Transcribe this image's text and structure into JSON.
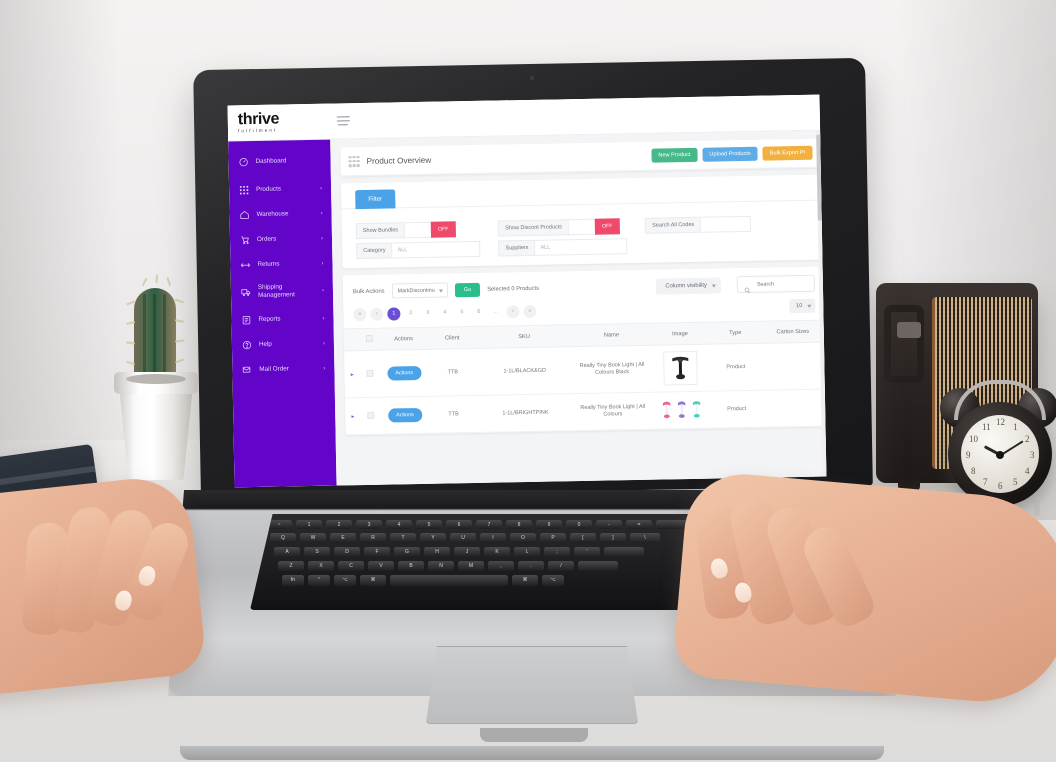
{
  "brand": {
    "logo_main": "thrive",
    "logo_sub": "fulfilment",
    "purple": "#6304c9"
  },
  "sidebar": {
    "items": [
      {
        "label": "Dashboard",
        "icon": "dashboard-icon",
        "has_chevron": false
      },
      {
        "label": "Products",
        "icon": "products-grid-icon",
        "has_chevron": true
      },
      {
        "label": "Warehouse",
        "icon": "warehouse-icon",
        "has_chevron": true
      },
      {
        "label": "Orders",
        "icon": "cart-icon",
        "has_chevron": true
      },
      {
        "label": "Returns",
        "icon": "returns-arrows-icon",
        "has_chevron": true
      },
      {
        "label": "Shipping Management",
        "icon": "truck-icon",
        "has_chevron": true
      },
      {
        "label": "Reports",
        "icon": "report-clipboard-icon",
        "has_chevron": true
      },
      {
        "label": "Help",
        "icon": "question-circle-icon",
        "has_chevron": true
      },
      {
        "label": "Mail Order",
        "icon": "mail-order-icon",
        "has_chevron": true
      }
    ],
    "chevron_glyph": "›"
  },
  "topbar": {
    "menu_icon": "hamburger-icon"
  },
  "page": {
    "title": "Product Overview",
    "grid_icon": "grid-dots-icon",
    "buttons": [
      {
        "label": "New Product",
        "color": "#45b98a"
      },
      {
        "label": "Upload Products",
        "color": "#5cace8"
      },
      {
        "label": "Bulk Export Pr",
        "color": "#f2b13f"
      }
    ]
  },
  "filter": {
    "tab_label": "Filter",
    "tab_color": "#4aa3e8",
    "off_label": "OFF",
    "off_color": "#ef4a6b",
    "fields": [
      {
        "label": "Show Bundles",
        "type": "toggle",
        "value": "OFF"
      },
      {
        "label": "Category",
        "type": "input",
        "value": "ALL"
      },
      {
        "label": "Show Discont Products",
        "type": "toggle",
        "value": "OFF"
      },
      {
        "label": "Suppliers",
        "type": "input",
        "value": "ALL"
      },
      {
        "label": "Search All Codes",
        "type": "input",
        "value": ""
      }
    ]
  },
  "toolbar": {
    "bulk_actions_label": "Bulk Actions",
    "bulk_select_value": "MarkDiscontinu",
    "go_label": "Go",
    "go_color": "#2bbd8d",
    "selected_text": "Selected 0 Products",
    "column_visibility_label": "Column visibility",
    "search_placeholder": "Search",
    "search_value": "",
    "search_icon": "magnifier-icon"
  },
  "pagination": {
    "first_glyph": "«",
    "prev_glyph": "‹",
    "pages": [
      "1",
      "2",
      "3",
      "4",
      "5",
      "6"
    ],
    "active_page": "1",
    "ellipsis": "…",
    "next_glyph": "›",
    "last_glyph": "»",
    "active_color": "#6a4fd6",
    "page_size": "10"
  },
  "table": {
    "columns": [
      "",
      "",
      "Actions",
      "Client",
      "SKU",
      "Name",
      "Image",
      "Type",
      "Carton Sizes"
    ],
    "rows": [
      {
        "expander": "▸",
        "actions_label": "Actions",
        "client": "TTB",
        "sku": "1-1L/BLACK&GD",
        "name": "Really Tiny Book Light | All Colours Black",
        "image": "book-light-black-thumbnail",
        "type": "Product",
        "carton_sizes": ""
      },
      {
        "expander": "▸",
        "actions_label": "Actions",
        "client": "TTB",
        "sku": "1-1L/BRIGHTPINK",
        "name": "Really Tiny Book Light | All Colours",
        "image": "book-light-colours-thumbnail",
        "type": "Product",
        "carton_sizes": ""
      }
    ]
  },
  "scene": {
    "objects": [
      {
        "name": "cactus-plant",
        "description": "cactus in white pot"
      },
      {
        "name": "vintage-radio",
        "description": "retro radio speaker"
      },
      {
        "name": "alarm-clock",
        "description": "twin bell alarm clock",
        "time": "10:10"
      },
      {
        "name": "notebook",
        "description": "dark notebook"
      },
      {
        "name": "macbook-laptop",
        "description": "silver laptop"
      },
      {
        "name": "left-hand",
        "description": "hand on keyboard"
      },
      {
        "name": "right-hand",
        "description": "hand on keyboard"
      }
    ],
    "clock_numerals": [
      "12",
      "1",
      "2",
      "3",
      "4",
      "5",
      "6",
      "7",
      "8",
      "9",
      "10",
      "11"
    ]
  }
}
